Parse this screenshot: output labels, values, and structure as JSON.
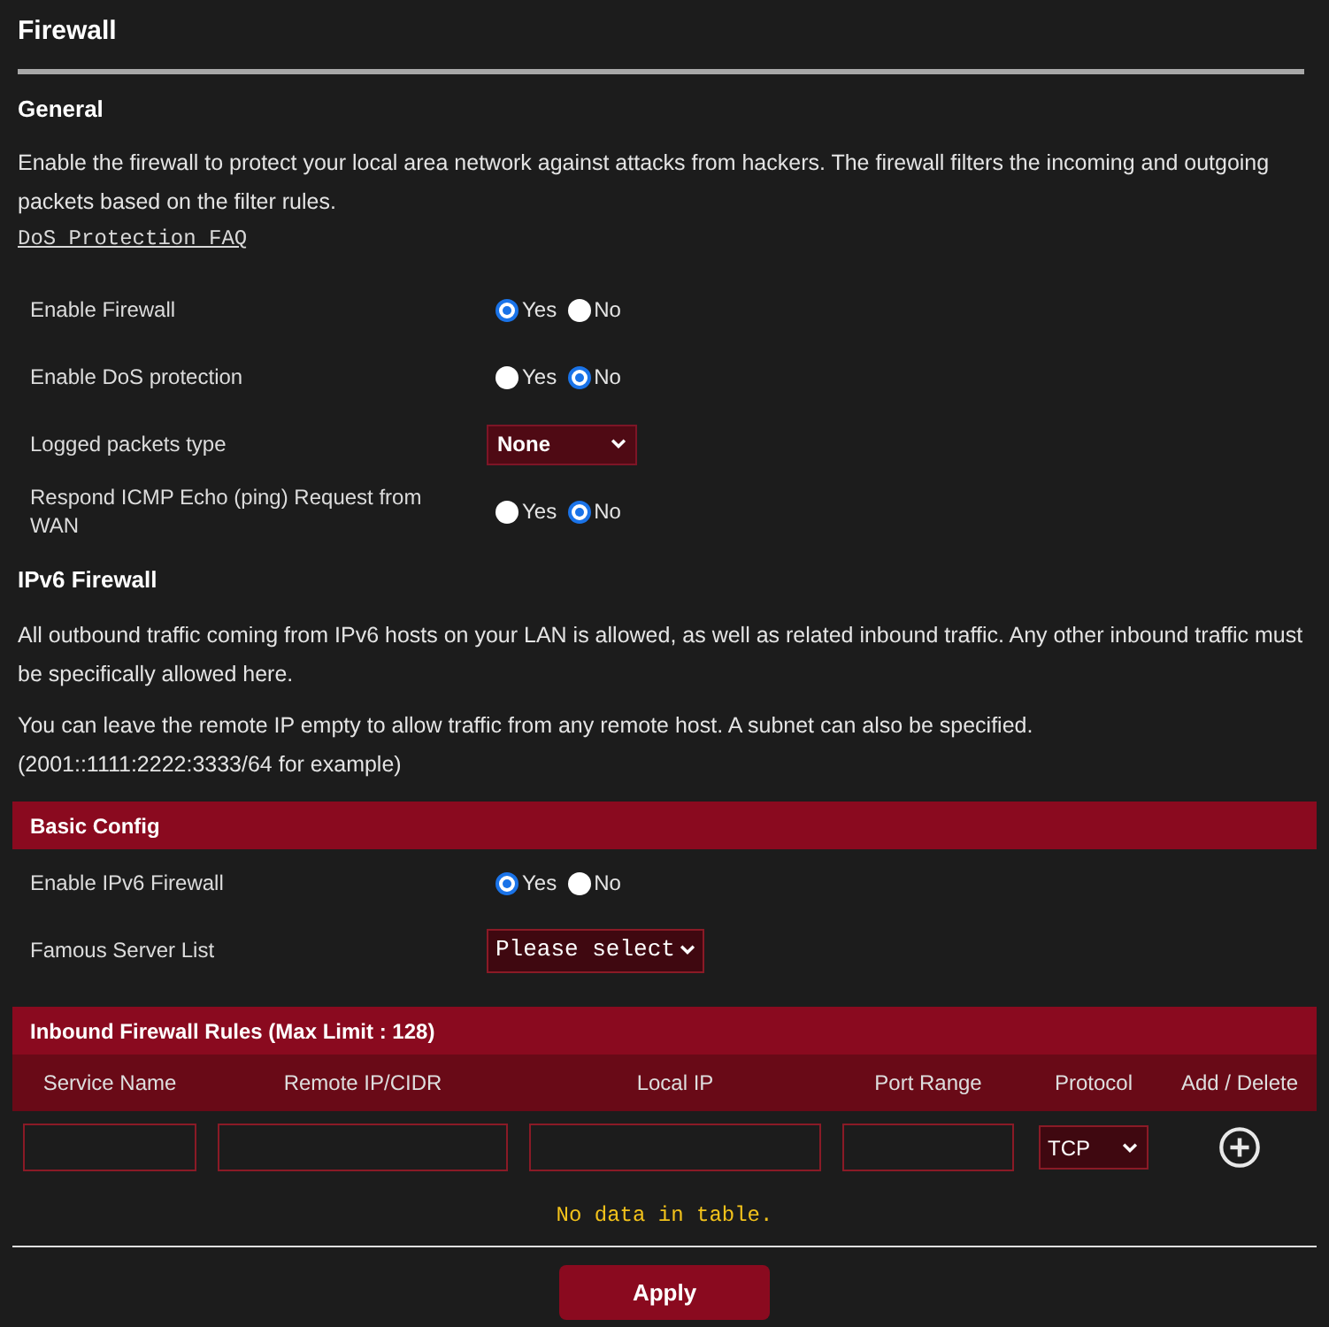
{
  "page": {
    "title": "Firewall"
  },
  "general": {
    "heading": "General",
    "description": "Enable the firewall to protect your local area network against attacks from hackers. The firewall filters the incoming and outgoing packets based on the filter rules.",
    "faq_link": "DoS Protection FAQ",
    "settings": [
      {
        "kind": "radio",
        "label": "Enable Firewall",
        "options": [
          {
            "label": "Yes",
            "selected": true
          },
          {
            "label": "No",
            "selected": false
          }
        ]
      },
      {
        "kind": "radio",
        "label": "Enable DoS protection",
        "options": [
          {
            "label": "Yes",
            "selected": false
          },
          {
            "label": "No",
            "selected": true
          }
        ]
      },
      {
        "kind": "select",
        "label": "Logged packets type",
        "value": "None"
      },
      {
        "kind": "radio",
        "label": "Respond ICMP Echo (ping) Request from WAN",
        "options": [
          {
            "label": "Yes",
            "selected": false
          },
          {
            "label": "No",
            "selected": true
          }
        ]
      }
    ]
  },
  "ipv6_firewall": {
    "heading": "IPv6 Firewall",
    "paragraphs": [
      "All outbound traffic coming from IPv6 hosts on your LAN is allowed, as well as related inbound traffic. Any other inbound traffic must be specifically allowed here.",
      "You can leave the remote IP empty to allow traffic from any remote host. A subnet can also be specified.\n(2001::1111:2222:3333/64 for example)"
    ]
  },
  "basic_config": {
    "heading": "Basic Config",
    "settings": [
      {
        "kind": "radio",
        "label": "Enable IPv6 Firewall",
        "options": [
          {
            "label": "Yes",
            "selected": true
          },
          {
            "label": "No",
            "selected": false
          }
        ]
      },
      {
        "kind": "select",
        "label": "Famous Server List",
        "value": "Please select"
      }
    ]
  },
  "inbound_rules": {
    "heading": "Inbound Firewall Rules (Max Limit : 128)",
    "columns": [
      "Service Name",
      "Remote IP/CIDR",
      "Local IP",
      "Port Range",
      "Protocol",
      "Add / Delete"
    ],
    "new_rule": {
      "protocol": "TCP"
    },
    "empty_message": "No data in table."
  },
  "apply_button": {
    "label": "Apply"
  }
}
